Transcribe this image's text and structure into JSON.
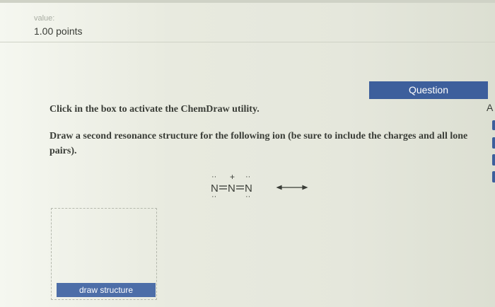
{
  "header": {
    "value_label": "value:",
    "points": "1.00 points"
  },
  "tab": {
    "label": "Question"
  },
  "side": {
    "letter": "A"
  },
  "question": {
    "instruction": "Click in the box to activate the ChemDraw utility.",
    "prompt": "Draw a second resonance structure for the following ion (be sure to include the charges and all lone pairs)."
  },
  "structure": {
    "atoms": [
      "N",
      "N",
      "N"
    ],
    "charge": "+",
    "lone_pair": "··"
  },
  "colors": {
    "accent": "#3d5f9c",
    "text": "#3a3d37"
  },
  "draw": {
    "button_label": "draw structure"
  }
}
